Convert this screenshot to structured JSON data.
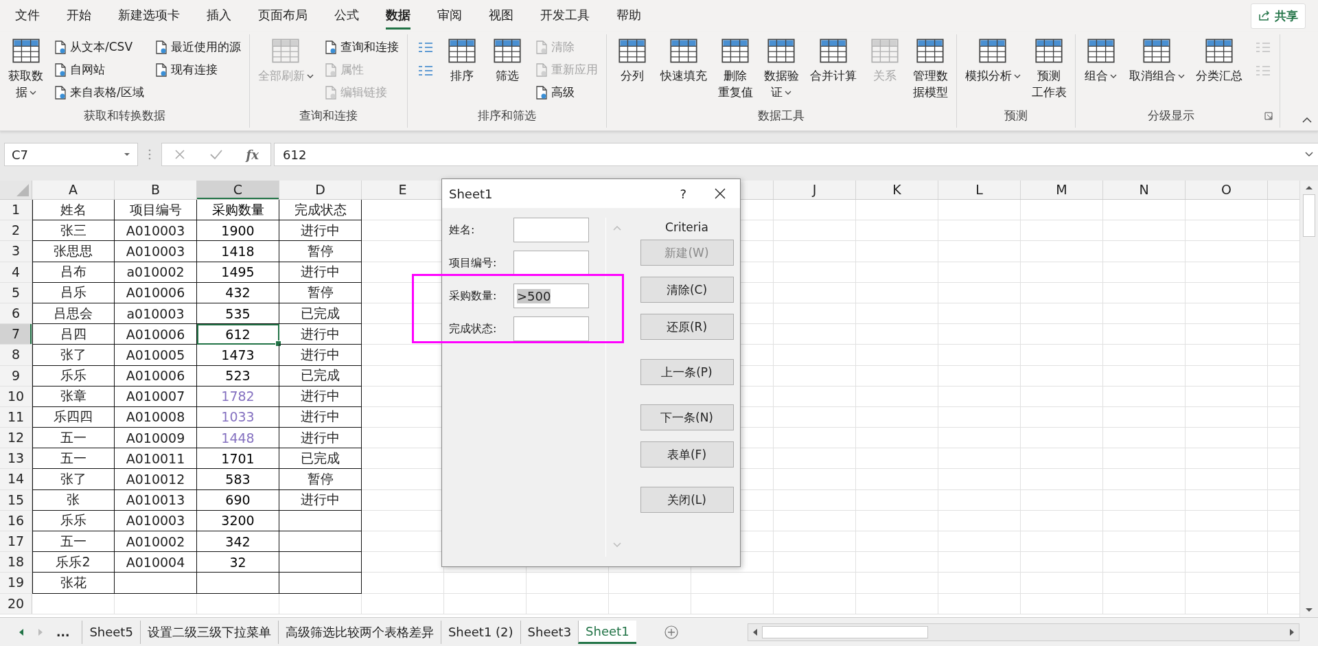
{
  "menu_tabs": [
    {
      "label": "文件",
      "selected": false
    },
    {
      "label": "开始",
      "selected": false
    },
    {
      "label": "新建选项卡",
      "selected": false
    },
    {
      "label": "插入",
      "selected": false
    },
    {
      "label": "页面布局",
      "selected": false
    },
    {
      "label": "公式",
      "selected": false
    },
    {
      "label": "数据",
      "selected": true
    },
    {
      "label": "审阅",
      "selected": false
    },
    {
      "label": "视图",
      "selected": false
    },
    {
      "label": "开发工具",
      "selected": false
    },
    {
      "label": "帮助",
      "selected": false
    }
  ],
  "share_button": "共享",
  "ribbon": [
    {
      "label": "获取和转换数据",
      "items": [
        {
          "kind": "big",
          "lines": [
            "获取数",
            "据"
          ],
          "disabled": false,
          "dropdown": true
        },
        {
          "kind": "stack",
          "items": [
            {
              "label": "从文本/CSV",
              "disabled": false
            },
            {
              "label": "自网站",
              "disabled": false
            },
            {
              "label": "来自表格/区域",
              "disabled": false
            }
          ]
        },
        {
          "kind": "stack",
          "items": [
            {
              "label": "最近使用的源",
              "disabled": false
            },
            {
              "label": "现有连接",
              "disabled": false
            }
          ]
        }
      ]
    },
    {
      "label": "查询和连接",
      "items": [
        {
          "kind": "big",
          "lines": [
            "全部刷新"
          ],
          "disabled": true,
          "dropdown": true
        },
        {
          "kind": "stack",
          "items": [
            {
              "label": "查询和连接",
              "disabled": false
            },
            {
              "label": "属性",
              "disabled": true
            },
            {
              "label": "编辑链接",
              "disabled": true
            }
          ]
        }
      ]
    },
    {
      "label": "排序和筛选",
      "items": [
        {
          "kind": "stack",
          "items": [
            {
              "disabled": false
            },
            {
              "disabled": false
            }
          ]
        },
        {
          "kind": "big",
          "lines": [
            "排序"
          ],
          "disabled": false
        },
        {
          "kind": "big",
          "lines": [
            "筛选"
          ],
          "disabled": false
        },
        {
          "kind": "stack",
          "items": [
            {
              "label": "清除",
              "disabled": true
            },
            {
              "label": "重新应用",
              "disabled": true
            },
            {
              "label": "高级",
              "disabled": false
            }
          ]
        }
      ]
    },
    {
      "label": "数据工具",
      "items": [
        {
          "kind": "big",
          "lines": [
            "分列"
          ],
          "disabled": false
        },
        {
          "kind": "big",
          "lines": [
            "快速填充"
          ],
          "disabled": false
        },
        {
          "kind": "big",
          "lines": [
            "删除",
            "重复值"
          ],
          "disabled": false
        },
        {
          "kind": "big",
          "lines": [
            "数据验",
            "证"
          ],
          "disabled": false,
          "dropdown": true
        },
        {
          "kind": "big",
          "lines": [
            "合并计算"
          ],
          "disabled": false
        },
        {
          "kind": "big",
          "lines": [
            "关系"
          ],
          "disabled": true
        },
        {
          "kind": "big",
          "lines": [
            "管理数",
            "据模型"
          ],
          "disabled": false
        }
      ]
    },
    {
      "label": "预测",
      "items": [
        {
          "kind": "big",
          "lines": [
            "模拟分析"
          ],
          "disabled": false,
          "dropdown": true
        },
        {
          "kind": "big",
          "lines": [
            "预测",
            "工作表"
          ],
          "disabled": false
        }
      ]
    },
    {
      "label": "分级显示",
      "launcher": true,
      "items": [
        {
          "kind": "big",
          "lines": [
            "组合"
          ],
          "disabled": false,
          "dropdown": true
        },
        {
          "kind": "big",
          "lines": [
            "取消组合"
          ],
          "disabled": false,
          "dropdown": true
        },
        {
          "kind": "big",
          "lines": [
            "分类汇总"
          ],
          "disabled": false
        },
        {
          "kind": "stack",
          "items": [
            {
              "disabled": true
            },
            {
              "disabled": true
            }
          ]
        }
      ]
    }
  ],
  "formula_bar": {
    "name_box": "C7",
    "fx_label": "fx",
    "value": "612"
  },
  "columns": [
    {
      "label": "A",
      "selected": false
    },
    {
      "label": "B",
      "selected": false
    },
    {
      "label": "C",
      "selected": true
    },
    {
      "label": "D",
      "selected": false
    },
    {
      "label": "E",
      "selected": false
    },
    {
      "label": "J",
      "selected": false
    },
    {
      "label": "K",
      "selected": false
    },
    {
      "label": "L",
      "selected": false
    },
    {
      "label": "M",
      "selected": false
    },
    {
      "label": "N",
      "selected": false
    },
    {
      "label": "O",
      "selected": false
    }
  ],
  "rows": [
    {
      "num": "1",
      "selected": false,
      "a": "姓名",
      "b": "项目编号",
      "c": "采购数量",
      "d": "完成状态",
      "color": "#000000"
    },
    {
      "num": "2",
      "selected": false,
      "a": "张三",
      "b": "A010003",
      "c": "1900",
      "d": "进行中",
      "color": "#000000"
    },
    {
      "num": "3",
      "selected": false,
      "a": "张思思",
      "b": "A010003",
      "c": "1418",
      "d": "暂停",
      "color": "#000000"
    },
    {
      "num": "4",
      "selected": false,
      "a": "吕布",
      "b": "a010002",
      "c": "1495",
      "d": "进行中",
      "color": "#000000"
    },
    {
      "num": "5",
      "selected": false,
      "a": "吕乐",
      "b": "A010006",
      "c": "432",
      "d": "暂停",
      "color": "#000000"
    },
    {
      "num": "6",
      "selected": false,
      "a": "吕思会",
      "b": "a010003",
      "c": "535",
      "d": "已完成",
      "color": "#000000"
    },
    {
      "num": "7",
      "selected": true,
      "a": "吕四",
      "b": "A010006",
      "c": "612",
      "d": "进行中",
      "color": "#000000"
    },
    {
      "num": "8",
      "selected": false,
      "a": "张了",
      "b": "A010005",
      "c": "1473",
      "d": "进行中",
      "color": "#000000"
    },
    {
      "num": "9",
      "selected": false,
      "a": "乐乐",
      "b": "A010006",
      "c": "523",
      "d": "已完成",
      "color": "#000000"
    },
    {
      "num": "10",
      "selected": false,
      "a": "张章",
      "b": "A010007",
      "c": "1782",
      "d": "进行中",
      "color": "#8470c0"
    },
    {
      "num": "11",
      "selected": false,
      "a": "乐四四",
      "b": "A010008",
      "c": "1033",
      "d": "进行中",
      "color": "#8470c0"
    },
    {
      "num": "12",
      "selected": false,
      "a": "五一",
      "b": "A010009",
      "c": "1448",
      "d": "进行中",
      "color": "#8470c0"
    },
    {
      "num": "13",
      "selected": false,
      "a": "五一",
      "b": "A010011",
      "c": "1701",
      "d": "已完成",
      "color": "#000000"
    },
    {
      "num": "14",
      "selected": false,
      "a": "张了",
      "b": "A010012",
      "c": "583",
      "d": "暂停",
      "color": "#000000"
    },
    {
      "num": "15",
      "selected": false,
      "a": "张",
      "b": "A010013",
      "c": "690",
      "d": "进行中",
      "color": "#000000"
    },
    {
      "num": "16",
      "selected": false,
      "a": "乐乐",
      "b": "A010003",
      "c": "3200",
      "color": "#000000"
    },
    {
      "num": "17",
      "selected": false,
      "a": "五一",
      "b": "A010002",
      "c": "342",
      "color": "#000000"
    },
    {
      "num": "18",
      "selected": false,
      "a": "乐乐2",
      "b": "A010004",
      "c": "32",
      "color": "#000000"
    },
    {
      "num": "19",
      "selected": false,
      "a": "张花"
    },
    {
      "num": "20",
      "selected": false
    }
  ],
  "sheet_nav": "...",
  "sheet_tabs": [
    {
      "label": "Sheet5",
      "selected": false
    },
    {
      "label": "设置二级三级下拉菜单",
      "selected": false
    },
    {
      "label": "高级筛选比较两个表格差异",
      "selected": false
    },
    {
      "label": "Sheet1 (2)",
      "selected": false
    },
    {
      "label": "Sheet3",
      "selected": false
    },
    {
      "label": "Sheet1",
      "selected": true
    }
  ],
  "dialog": {
    "title": "Sheet1",
    "help": "?",
    "mode": "Criteria",
    "fields": [
      {
        "label": "姓名:"
      },
      {
        "label": "项目编号:"
      },
      {
        "label": "采购数量:",
        "value": ">500"
      },
      {
        "label": "完成状态:"
      }
    ],
    "buttons": [
      {
        "label": "新建(W)",
        "disabled": true
      },
      {
        "label": "清除(C)",
        "disabled": false
      },
      {
        "label": "还原(R)",
        "disabled": false
      },
      {
        "label": "上一条(P)",
        "disabled": false
      },
      {
        "label": "下一条(N)",
        "disabled": false
      },
      {
        "label": "表单(F)",
        "disabled": false
      },
      {
        "label": "关闭(L)",
        "disabled": false
      }
    ]
  }
}
